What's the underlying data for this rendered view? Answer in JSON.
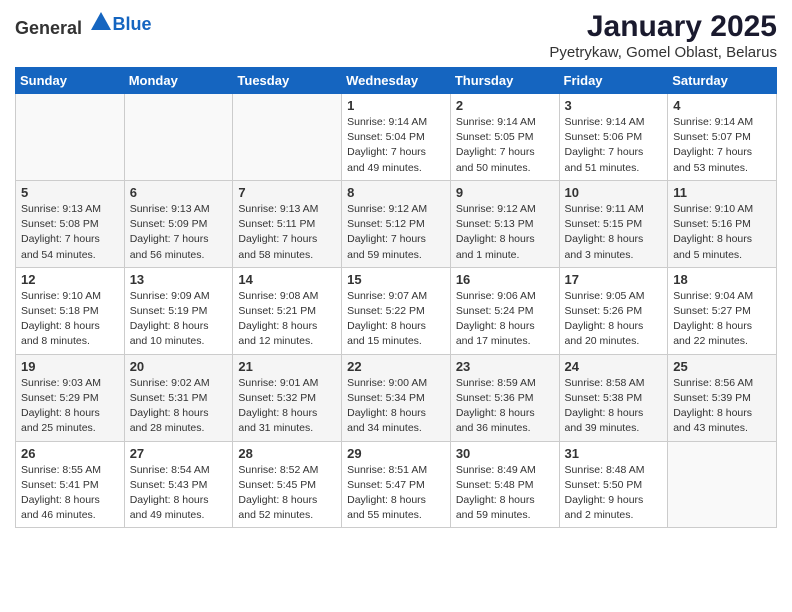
{
  "logo": {
    "general": "General",
    "blue": "Blue"
  },
  "title": "January 2025",
  "subtitle": "Pyetrykaw, Gomel Oblast, Belarus",
  "days_of_week": [
    "Sunday",
    "Monday",
    "Tuesday",
    "Wednesday",
    "Thursday",
    "Friday",
    "Saturday"
  ],
  "weeks": [
    [
      {
        "day": "",
        "info": ""
      },
      {
        "day": "",
        "info": ""
      },
      {
        "day": "",
        "info": ""
      },
      {
        "day": "1",
        "info": "Sunrise: 9:14 AM\nSunset: 5:04 PM\nDaylight: 7 hours\nand 49 minutes."
      },
      {
        "day": "2",
        "info": "Sunrise: 9:14 AM\nSunset: 5:05 PM\nDaylight: 7 hours\nand 50 minutes."
      },
      {
        "day": "3",
        "info": "Sunrise: 9:14 AM\nSunset: 5:06 PM\nDaylight: 7 hours\nand 51 minutes."
      },
      {
        "day": "4",
        "info": "Sunrise: 9:14 AM\nSunset: 5:07 PM\nDaylight: 7 hours\nand 53 minutes."
      }
    ],
    [
      {
        "day": "5",
        "info": "Sunrise: 9:13 AM\nSunset: 5:08 PM\nDaylight: 7 hours\nand 54 minutes."
      },
      {
        "day": "6",
        "info": "Sunrise: 9:13 AM\nSunset: 5:09 PM\nDaylight: 7 hours\nand 56 minutes."
      },
      {
        "day": "7",
        "info": "Sunrise: 9:13 AM\nSunset: 5:11 PM\nDaylight: 7 hours\nand 58 minutes."
      },
      {
        "day": "8",
        "info": "Sunrise: 9:12 AM\nSunset: 5:12 PM\nDaylight: 7 hours\nand 59 minutes."
      },
      {
        "day": "9",
        "info": "Sunrise: 9:12 AM\nSunset: 5:13 PM\nDaylight: 8 hours\nand 1 minute."
      },
      {
        "day": "10",
        "info": "Sunrise: 9:11 AM\nSunset: 5:15 PM\nDaylight: 8 hours\nand 3 minutes."
      },
      {
        "day": "11",
        "info": "Sunrise: 9:10 AM\nSunset: 5:16 PM\nDaylight: 8 hours\nand 5 minutes."
      }
    ],
    [
      {
        "day": "12",
        "info": "Sunrise: 9:10 AM\nSunset: 5:18 PM\nDaylight: 8 hours\nand 8 minutes."
      },
      {
        "day": "13",
        "info": "Sunrise: 9:09 AM\nSunset: 5:19 PM\nDaylight: 8 hours\nand 10 minutes."
      },
      {
        "day": "14",
        "info": "Sunrise: 9:08 AM\nSunset: 5:21 PM\nDaylight: 8 hours\nand 12 minutes."
      },
      {
        "day": "15",
        "info": "Sunrise: 9:07 AM\nSunset: 5:22 PM\nDaylight: 8 hours\nand 15 minutes."
      },
      {
        "day": "16",
        "info": "Sunrise: 9:06 AM\nSunset: 5:24 PM\nDaylight: 8 hours\nand 17 minutes."
      },
      {
        "day": "17",
        "info": "Sunrise: 9:05 AM\nSunset: 5:26 PM\nDaylight: 8 hours\nand 20 minutes."
      },
      {
        "day": "18",
        "info": "Sunrise: 9:04 AM\nSunset: 5:27 PM\nDaylight: 8 hours\nand 22 minutes."
      }
    ],
    [
      {
        "day": "19",
        "info": "Sunrise: 9:03 AM\nSunset: 5:29 PM\nDaylight: 8 hours\nand 25 minutes."
      },
      {
        "day": "20",
        "info": "Sunrise: 9:02 AM\nSunset: 5:31 PM\nDaylight: 8 hours\nand 28 minutes."
      },
      {
        "day": "21",
        "info": "Sunrise: 9:01 AM\nSunset: 5:32 PM\nDaylight: 8 hours\nand 31 minutes."
      },
      {
        "day": "22",
        "info": "Sunrise: 9:00 AM\nSunset: 5:34 PM\nDaylight: 8 hours\nand 34 minutes."
      },
      {
        "day": "23",
        "info": "Sunrise: 8:59 AM\nSunset: 5:36 PM\nDaylight: 8 hours\nand 36 minutes."
      },
      {
        "day": "24",
        "info": "Sunrise: 8:58 AM\nSunset: 5:38 PM\nDaylight: 8 hours\nand 39 minutes."
      },
      {
        "day": "25",
        "info": "Sunrise: 8:56 AM\nSunset: 5:39 PM\nDaylight: 8 hours\nand 43 minutes."
      }
    ],
    [
      {
        "day": "26",
        "info": "Sunrise: 8:55 AM\nSunset: 5:41 PM\nDaylight: 8 hours\nand 46 minutes."
      },
      {
        "day": "27",
        "info": "Sunrise: 8:54 AM\nSunset: 5:43 PM\nDaylight: 8 hours\nand 49 minutes."
      },
      {
        "day": "28",
        "info": "Sunrise: 8:52 AM\nSunset: 5:45 PM\nDaylight: 8 hours\nand 52 minutes."
      },
      {
        "day": "29",
        "info": "Sunrise: 8:51 AM\nSunset: 5:47 PM\nDaylight: 8 hours\nand 55 minutes."
      },
      {
        "day": "30",
        "info": "Sunrise: 8:49 AM\nSunset: 5:48 PM\nDaylight: 8 hours\nand 59 minutes."
      },
      {
        "day": "31",
        "info": "Sunrise: 8:48 AM\nSunset: 5:50 PM\nDaylight: 9 hours\nand 2 minutes."
      },
      {
        "day": "",
        "info": ""
      }
    ]
  ]
}
